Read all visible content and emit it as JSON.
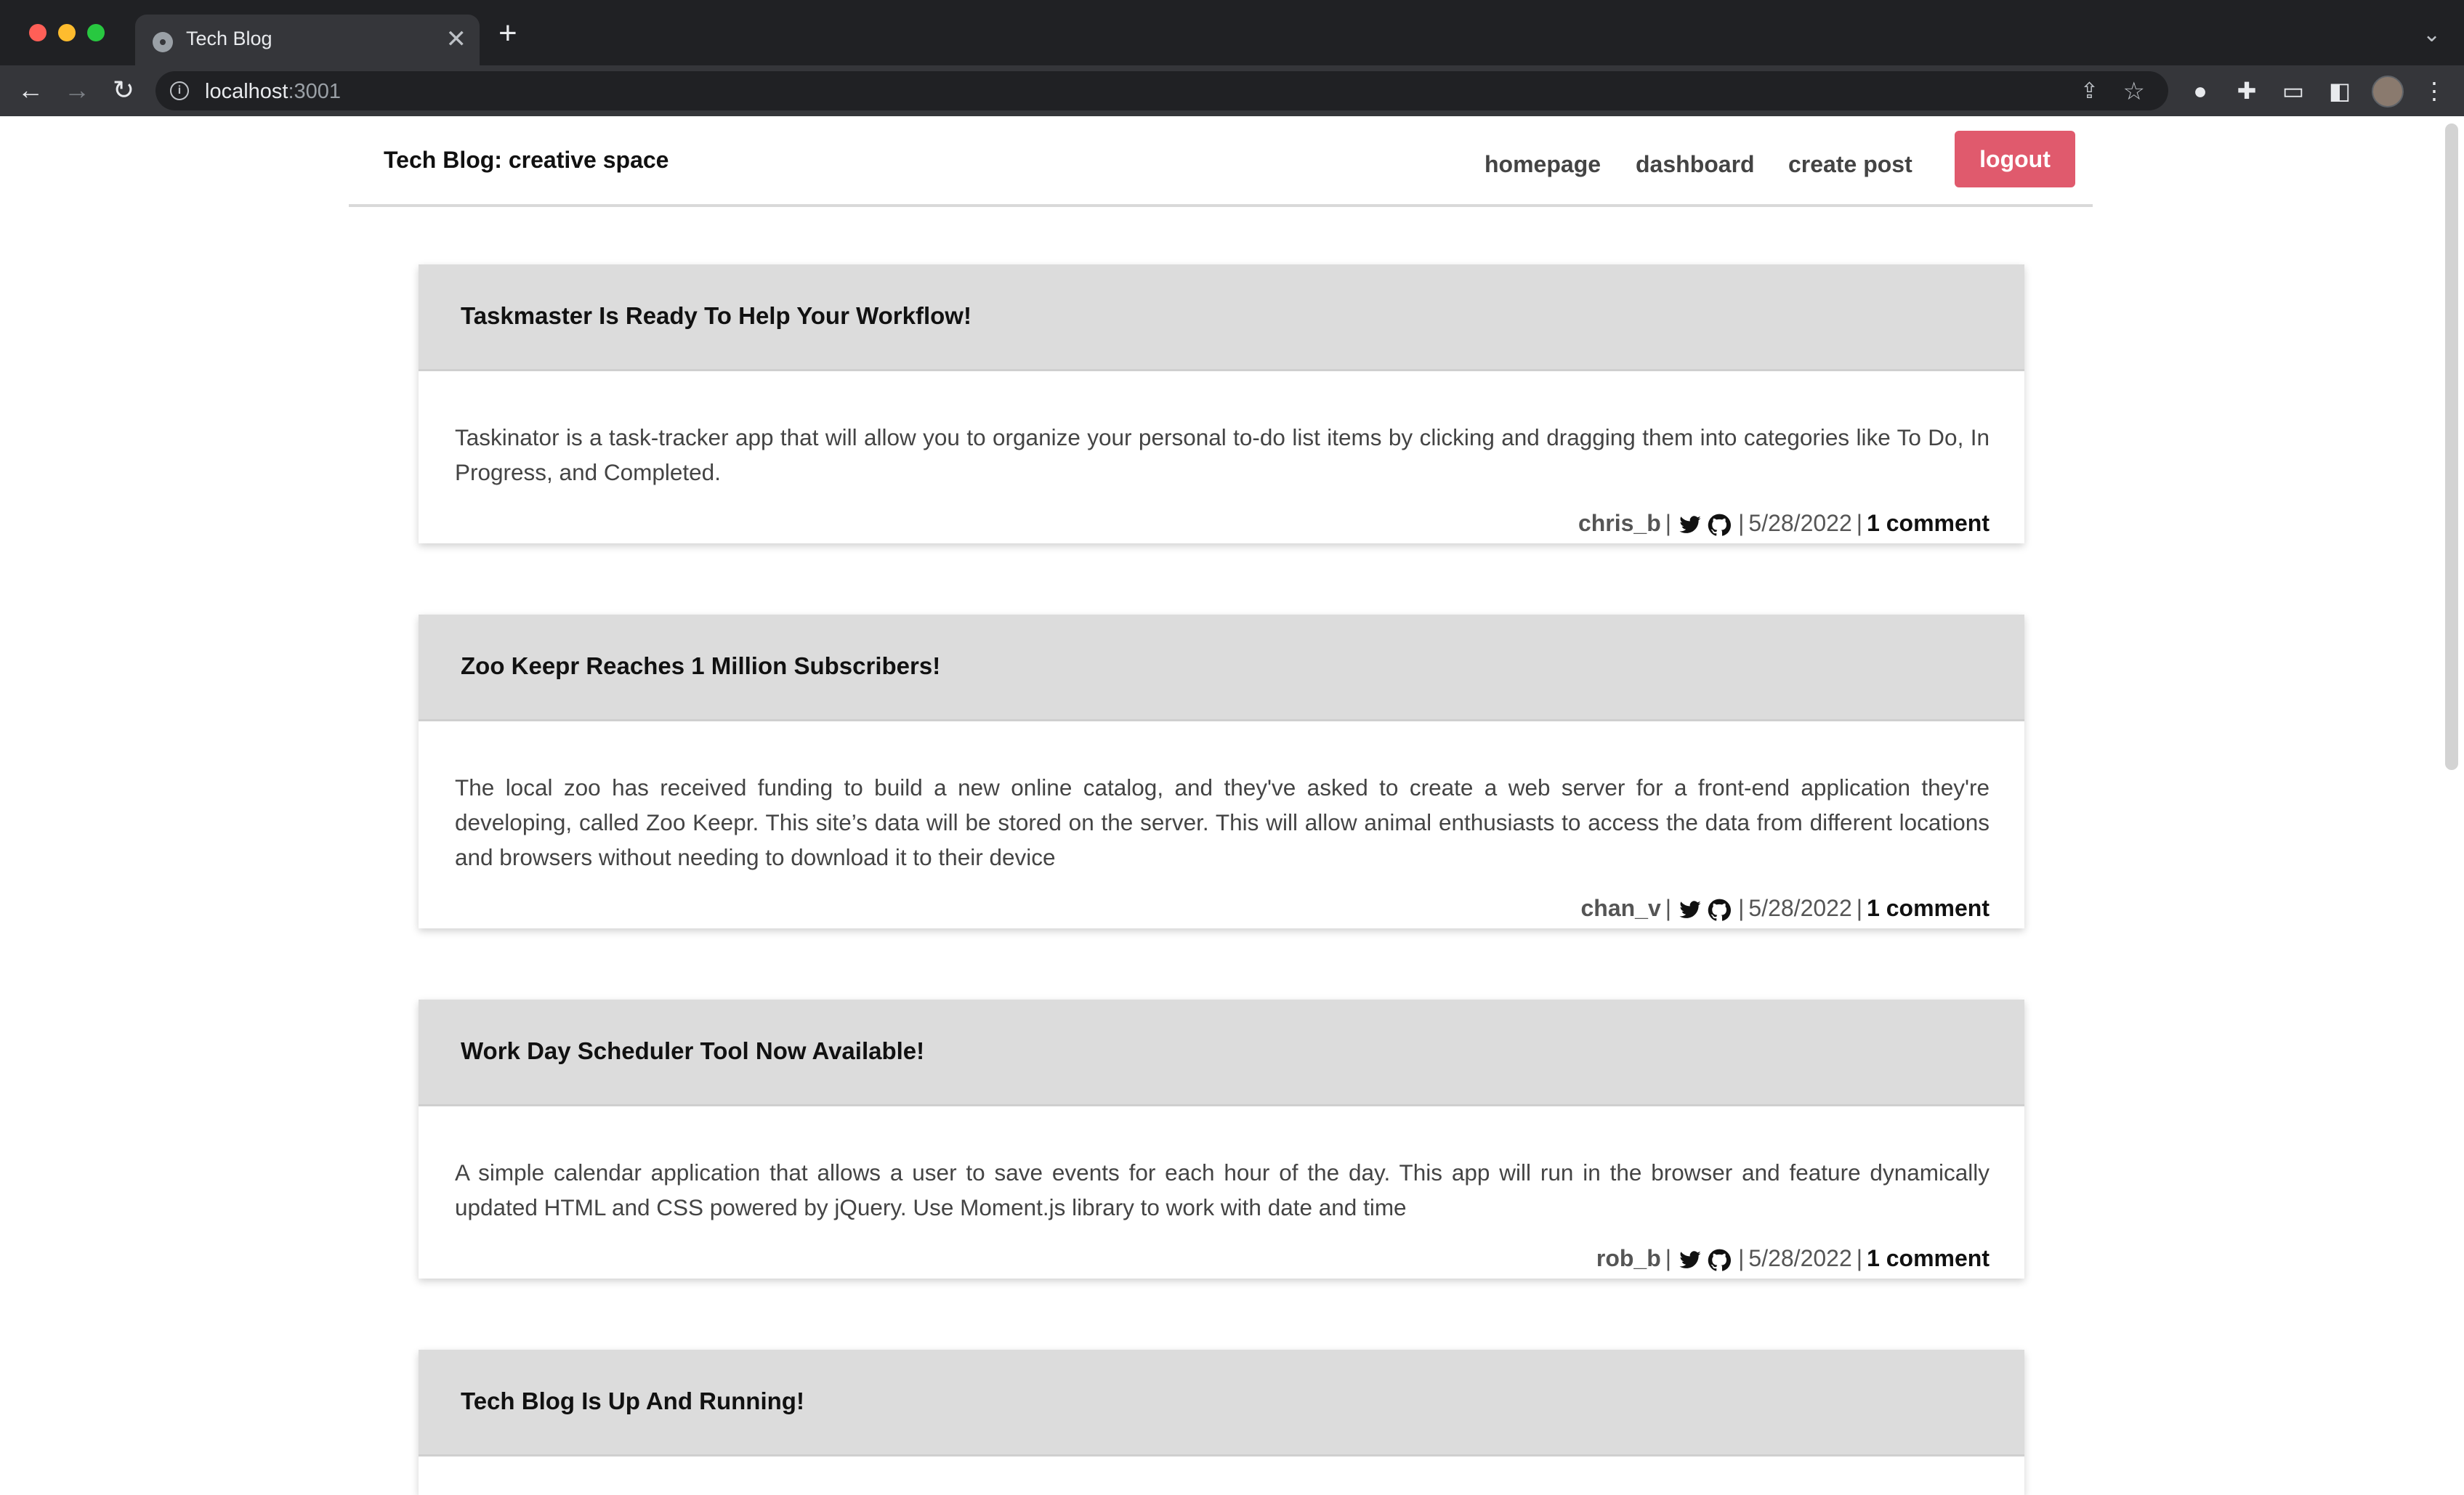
{
  "browser": {
    "tab_title": "Tech Blog",
    "tab_close": "✕",
    "new_tab": "+",
    "url_host": "localhost",
    "url_port": ":3001"
  },
  "site": {
    "title": "Tech Blog: creative space",
    "nav": {
      "homepage": "homepage",
      "dashboard": "dashboard",
      "create_post": "create post",
      "logout": "logout"
    },
    "accent_color": "#e05a6d"
  },
  "posts": [
    {
      "title": "Taskmaster Is Ready To Help Your Workflow!",
      "body": "Taskinator is a task-tracker app that will allow you to organize your personal to-do list items by clicking and dragging them into categories like To Do, In Progress, and Completed.",
      "author": "chris_b",
      "date": "5/28/2022",
      "comments": "1 comment"
    },
    {
      "title": "Zoo Keepr Reaches 1 Million Subscribers!",
      "body": "The local zoo has received funding to build a new online catalog, and they've asked to create a web server for a front-end application they're developing, called Zoo Keepr. This site’s data will be stored on the server. This will allow animal enthusiasts to access the data from different locations and browsers without needing to download it to their device",
      "author": "chan_v",
      "date": "5/28/2022",
      "comments": "1 comment"
    },
    {
      "title": "Work Day Scheduler Tool Now Available!",
      "body": "A simple calendar application that allows a user to save events for each hour of the day. This app will run in the browser and feature dynamically updated HTML and CSS powered by jQuery. Use Moment.js library to work with date and time",
      "author": "rob_b",
      "date": "5/28/2022",
      "comments": "1 comment"
    },
    {
      "title": "Tech Blog Is Up And Running!"
    }
  ],
  "meta_separator": "|",
  "icons": [
    "twitter-icon",
    "github-icon"
  ]
}
